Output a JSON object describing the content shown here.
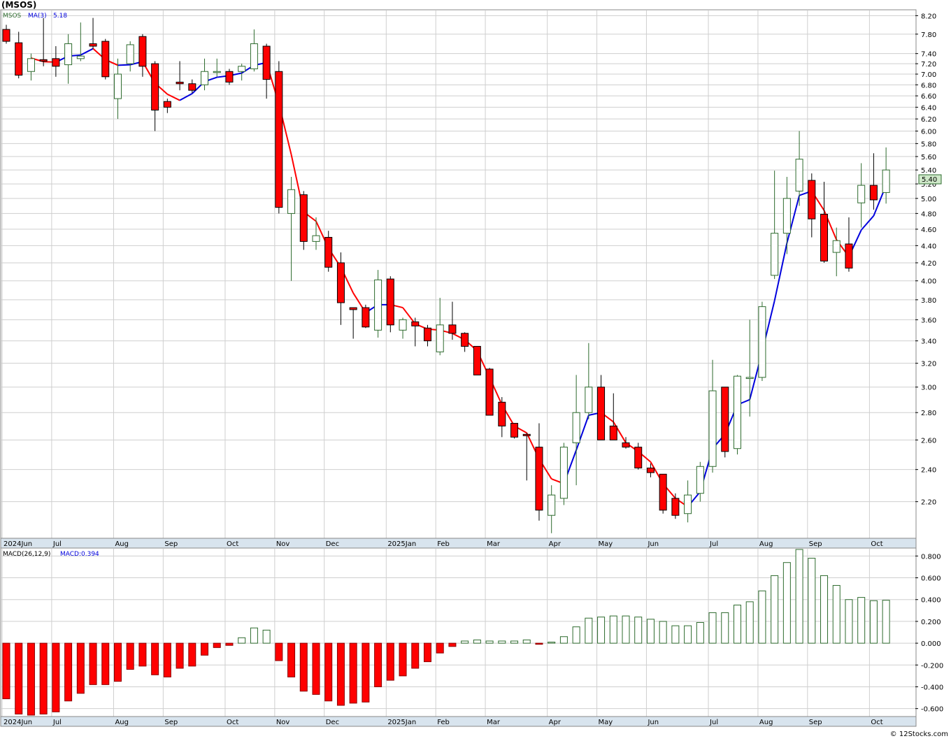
{
  "header": {
    "symbol": "(MSOS)",
    "legend_symbol": "MSOS",
    "legend_ma_label": "MA(3)",
    "legend_ma_value": "5.18",
    "last_price_tag": "5.40",
    "macd_label": "MACD(26,12,9)",
    "macd_value_label": "MACD:0.394",
    "watermark": "© 12Stocks.com"
  },
  "colors": {
    "background": "#ffffff",
    "grid": "#cfcfcf",
    "axis_band": "#d8e4ee",
    "up_candle_border": "#2e6b2e",
    "down_candle_fill": "#ff0000",
    "ma_up": "#0000dd",
    "ma_down": "#ff0000",
    "macd_pos": "#2e6b2e",
    "macd_neg": "#ff0000",
    "price_tag_bg": "#cfe8c9"
  },
  "chart_data": [
    {
      "type": "candlestick",
      "title": "(MSOS)",
      "interval": "weekly",
      "y_scale": "log",
      "ylim": [
        2.0,
        8.3
      ],
      "y_ticks": [
        "2.20",
        "2.40",
        "2.60",
        "2.80",
        "3.00",
        "3.20",
        "3.40",
        "3.60",
        "3.80",
        "4.00",
        "4.20",
        "4.40",
        "4.60",
        "4.80",
        "5.00",
        "5.20",
        "5.40",
        "5.60",
        "5.80",
        "6.00",
        "6.20",
        "6.40",
        "6.60",
        "6.80",
        "7.00",
        "7.20",
        "7.40",
        "7.80",
        "8.20"
      ],
      "x_labels": [
        {
          "label": "2024Jun",
          "index": 0
        },
        {
          "label": "Jul",
          "index": 4
        },
        {
          "label": "Aug",
          "index": 9
        },
        {
          "label": "Sep",
          "index": 13
        },
        {
          "label": "Oct",
          "index": 18
        },
        {
          "label": "Nov",
          "index": 22
        },
        {
          "label": "Dec",
          "index": 26
        },
        {
          "label": "2025Jan",
          "index": 31
        },
        {
          "label": "Feb",
          "index": 35
        },
        {
          "label": "Mar",
          "index": 39
        },
        {
          "label": "Apr",
          "index": 44
        },
        {
          "label": "May",
          "index": 48
        },
        {
          "label": "Jun",
          "index": 52
        },
        {
          "label": "Jul",
          "index": 57
        },
        {
          "label": "Aug",
          "index": 61
        },
        {
          "label": "Sep",
          "index": 65
        },
        {
          "label": "Oct",
          "index": 70
        }
      ],
      "candles": [
        {
          "o": 7.9,
          "h": 8.0,
          "l": 7.6,
          "c": 7.65
        },
        {
          "o": 7.62,
          "h": 7.85,
          "l": 6.92,
          "c": 6.98
        },
        {
          "o": 7.05,
          "h": 7.4,
          "l": 6.88,
          "c": 7.3
        },
        {
          "o": 7.28,
          "h": 8.15,
          "l": 7.15,
          "c": 7.25
        },
        {
          "o": 7.3,
          "h": 7.55,
          "l": 6.95,
          "c": 7.15
        },
        {
          "o": 7.18,
          "h": 7.8,
          "l": 6.82,
          "c": 7.6
        },
        {
          "o": 7.3,
          "h": 8.05,
          "l": 7.25,
          "c": 7.35
        },
        {
          "o": 7.6,
          "h": 8.15,
          "l": 7.5,
          "c": 7.55
        },
        {
          "o": 7.65,
          "h": 7.7,
          "l": 6.9,
          "c": 6.95
        },
        {
          "o": 6.55,
          "h": 7.3,
          "l": 6.2,
          "c": 7.0
        },
        {
          "o": 7.2,
          "h": 7.65,
          "l": 7.05,
          "c": 7.58
        },
        {
          "o": 7.75,
          "h": 7.8,
          "l": 6.95,
          "c": 7.15
        },
        {
          "o": 7.2,
          "h": 7.25,
          "l": 6.0,
          "c": 6.35
        },
        {
          "o": 6.5,
          "h": 6.55,
          "l": 6.3,
          "c": 6.4
        },
        {
          "o": 6.85,
          "h": 7.25,
          "l": 6.7,
          "c": 6.82
        },
        {
          "o": 6.82,
          "h": 6.9,
          "l": 6.65,
          "c": 6.7
        },
        {
          "o": 6.8,
          "h": 7.3,
          "l": 6.7,
          "c": 7.05
        },
        {
          "o": 7.05,
          "h": 7.3,
          "l": 6.95,
          "c": 7.05
        },
        {
          "o": 7.05,
          "h": 7.1,
          "l": 6.8,
          "c": 6.85
        },
        {
          "o": 7.05,
          "h": 7.2,
          "l": 6.88,
          "c": 7.15
        },
        {
          "o": 7.1,
          "h": 7.9,
          "l": 7.05,
          "c": 7.6
        },
        {
          "o": 7.55,
          "h": 7.6,
          "l": 6.55,
          "c": 6.9
        },
        {
          "o": 7.05,
          "h": 7.25,
          "l": 4.8,
          "c": 4.88
        },
        {
          "o": 4.8,
          "h": 5.3,
          "l": 4.0,
          "c": 5.12
        },
        {
          "o": 5.05,
          "h": 5.1,
          "l": 4.35,
          "c": 4.45
        },
        {
          "o": 4.45,
          "h": 4.75,
          "l": 4.35,
          "c": 4.52
        },
        {
          "o": 4.5,
          "h": 4.58,
          "l": 4.1,
          "c": 4.15
        },
        {
          "o": 4.2,
          "h": 4.32,
          "l": 3.55,
          "c": 3.77
        },
        {
          "o": 3.72,
          "h": 3.72,
          "l": 3.42,
          "c": 3.7
        },
        {
          "o": 3.72,
          "h": 3.75,
          "l": 3.52,
          "c": 3.53
        },
        {
          "o": 3.5,
          "h": 4.12,
          "l": 3.43,
          "c": 4.01
        },
        {
          "o": 4.02,
          "h": 4.05,
          "l": 3.48,
          "c": 3.55
        },
        {
          "o": 3.5,
          "h": 3.62,
          "l": 3.42,
          "c": 3.6
        },
        {
          "o": 3.58,
          "h": 3.62,
          "l": 3.35,
          "c": 3.54
        },
        {
          "o": 3.52,
          "h": 3.55,
          "l": 3.35,
          "c": 3.4
        },
        {
          "o": 3.3,
          "h": 3.82,
          "l": 3.27,
          "c": 3.55
        },
        {
          "o": 3.55,
          "h": 3.78,
          "l": 3.41,
          "c": 3.47
        },
        {
          "o": 3.47,
          "h": 3.48,
          "l": 3.3,
          "c": 3.35
        },
        {
          "o": 3.35,
          "h": 3.35,
          "l": 3.15,
          "c": 3.1
        },
        {
          "o": 3.15,
          "h": 3.16,
          "l": 2.78,
          "c": 2.78
        },
        {
          "o": 2.88,
          "h": 2.92,
          "l": 2.62,
          "c": 2.7
        },
        {
          "o": 2.72,
          "h": 2.72,
          "l": 2.61,
          "c": 2.62
        },
        {
          "o": 2.64,
          "h": 2.65,
          "l": 2.33,
          "c": 2.63
        },
        {
          "o": 2.55,
          "h": 2.72,
          "l": 2.09,
          "c": 2.15
        },
        {
          "o": 2.12,
          "h": 2.3,
          "l": 2.02,
          "c": 2.24
        },
        {
          "o": 2.22,
          "h": 2.58,
          "l": 2.18,
          "c": 2.55
        },
        {
          "o": 2.58,
          "h": 3.1,
          "l": 2.3,
          "c": 2.8
        },
        {
          "o": 2.8,
          "h": 3.38,
          "l": 2.75,
          "c": 3.0
        },
        {
          "o": 3.0,
          "h": 3.1,
          "l": 2.6,
          "c": 2.6
        },
        {
          "o": 2.7,
          "h": 2.95,
          "l": 2.6,
          "c": 2.6
        },
        {
          "o": 2.58,
          "h": 2.62,
          "l": 2.54,
          "c": 2.55
        },
        {
          "o": 2.55,
          "h": 2.58,
          "l": 2.4,
          "c": 2.41
        },
        {
          "o": 2.41,
          "h": 2.44,
          "l": 2.35,
          "c": 2.38
        },
        {
          "o": 2.37,
          "h": 2.37,
          "l": 2.13,
          "c": 2.15
        },
        {
          "o": 2.22,
          "h": 2.25,
          "l": 2.1,
          "c": 2.12
        },
        {
          "o": 2.13,
          "h": 2.33,
          "l": 2.08,
          "c": 2.24
        },
        {
          "o": 2.25,
          "h": 2.45,
          "l": 2.2,
          "c": 2.42
        },
        {
          "o": 2.42,
          "h": 3.23,
          "l": 2.38,
          "c": 2.97
        },
        {
          "o": 3.0,
          "h": 3.0,
          "l": 2.48,
          "c": 2.52
        },
        {
          "o": 2.54,
          "h": 3.1,
          "l": 2.5,
          "c": 3.09
        },
        {
          "o": 3.07,
          "h": 3.6,
          "l": 2.77,
          "c": 3.08
        },
        {
          "o": 3.08,
          "h": 3.78,
          "l": 3.05,
          "c": 3.73
        },
        {
          "o": 4.06,
          "h": 5.39,
          "l": 4.02,
          "c": 4.55
        },
        {
          "o": 4.55,
          "h": 5.3,
          "l": 4.3,
          "c": 5.0
        },
        {
          "o": 5.1,
          "h": 6.0,
          "l": 4.9,
          "c": 5.56
        },
        {
          "o": 5.25,
          "h": 5.35,
          "l": 4.5,
          "c": 4.73
        },
        {
          "o": 4.79,
          "h": 5.23,
          "l": 4.2,
          "c": 4.22
        },
        {
          "o": 4.32,
          "h": 4.62,
          "l": 4.05,
          "c": 4.46
        },
        {
          "o": 4.42,
          "h": 4.75,
          "l": 4.1,
          "c": 4.14
        },
        {
          "o": 4.94,
          "h": 5.5,
          "l": 4.62,
          "c": 5.18
        },
        {
          "o": 5.18,
          "h": 5.65,
          "l": 4.85,
          "c": 4.98
        },
        {
          "o": 5.08,
          "h": 5.74,
          "l": 4.93,
          "c": 5.4
        }
      ],
      "ma3": [
        null,
        null,
        7.31,
        7.24,
        7.23,
        7.35,
        7.37,
        7.5,
        7.28,
        7.17,
        7.18,
        7.24,
        6.83,
        6.63,
        6.52,
        6.64,
        6.86,
        6.94,
        6.97,
        7.02,
        7.17,
        7.22,
        6.46,
        5.63,
        4.82,
        4.7,
        4.37,
        4.15,
        3.87,
        3.67,
        3.75,
        3.75,
        3.72,
        3.56,
        3.51,
        3.5,
        3.47,
        3.41,
        3.31,
        3.08,
        2.86,
        2.7,
        2.65,
        2.47,
        2.34,
        2.31,
        2.53,
        2.78,
        2.8,
        2.73,
        2.58,
        2.52,
        2.45,
        2.31,
        2.22,
        2.17,
        2.26,
        2.54,
        2.64,
        2.86,
        2.9,
        3.3,
        3.79,
        4.43,
        5.04,
        5.1,
        4.84,
        4.47,
        4.27,
        4.59,
        4.77,
        5.18
      ]
    },
    {
      "type": "bar",
      "title": "MACD(26,12,9)",
      "ylim": [
        -0.66,
        0.86
      ],
      "y_ticks": [
        "-0.600",
        "-0.400",
        "-0.200",
        "0.000",
        "0.200",
        "0.400",
        "0.600",
        "0.800"
      ],
      "x_labels": [
        {
          "label": "2024Jun",
          "index": 0
        },
        {
          "label": "Jul",
          "index": 4
        },
        {
          "label": "Aug",
          "index": 9
        },
        {
          "label": "Sep",
          "index": 13
        },
        {
          "label": "Oct",
          "index": 18
        },
        {
          "label": "Nov",
          "index": 22
        },
        {
          "label": "Dec",
          "index": 26
        },
        {
          "label": "2025Jan",
          "index": 31
        },
        {
          "label": "Feb",
          "index": 35
        },
        {
          "label": "Mar",
          "index": 39
        },
        {
          "label": "Apr",
          "index": 44
        },
        {
          "label": "May",
          "index": 48
        },
        {
          "label": "Jun",
          "index": 52
        },
        {
          "label": "Jul",
          "index": 57
        },
        {
          "label": "Aug",
          "index": 61
        },
        {
          "label": "Sep",
          "index": 65
        },
        {
          "label": "Oct",
          "index": 70
        }
      ],
      "values": [
        -0.51,
        -0.65,
        -0.66,
        -0.65,
        -0.63,
        -0.53,
        -0.46,
        -0.38,
        -0.38,
        -0.35,
        -0.24,
        -0.21,
        -0.29,
        -0.31,
        -0.23,
        -0.21,
        -0.11,
        -0.04,
        -0.02,
        0.05,
        0.14,
        0.12,
        -0.16,
        -0.31,
        -0.44,
        -0.47,
        -0.53,
        -0.57,
        -0.55,
        -0.54,
        -0.4,
        -0.34,
        -0.3,
        -0.23,
        -0.17,
        -0.09,
        -0.03,
        0.02,
        0.03,
        0.02,
        0.02,
        0.02,
        0.03,
        -0.01,
        0.01,
        0.06,
        0.15,
        0.23,
        0.24,
        0.25,
        0.25,
        0.24,
        0.22,
        0.2,
        0.16,
        0.16,
        0.19,
        0.28,
        0.28,
        0.35,
        0.38,
        0.48,
        0.62,
        0.74,
        0.86,
        0.78,
        0.62,
        0.53,
        0.4,
        0.42,
        0.39,
        0.394
      ]
    }
  ]
}
